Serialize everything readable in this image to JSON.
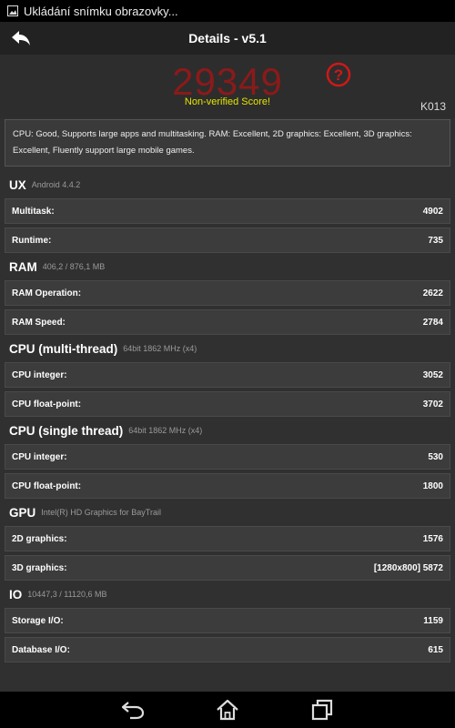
{
  "statusbar": {
    "text": "Ukládání snímku obrazovky..."
  },
  "actionbar": {
    "title": "Details - v5.1"
  },
  "score": {
    "value": "29349",
    "note": "Non-verified Score!",
    "device": "K013"
  },
  "summary": "CPU: Good, Supports large apps and multitasking. RAM: Excellent, 2D graphics: Excellent, 3D graphics: Excellent, Fluently support large mobile games.",
  "sections": [
    {
      "title": "UX",
      "subtitle": "Android 4.4.2",
      "rows": [
        {
          "label": "Multitask:",
          "value": "4902"
        },
        {
          "label": "Runtime:",
          "value": "735"
        }
      ]
    },
    {
      "title": "RAM",
      "subtitle": "406,2 / 876,1 MB",
      "rows": [
        {
          "label": "RAM Operation:",
          "value": "2622"
        },
        {
          "label": "RAM Speed:",
          "value": "2784"
        }
      ]
    },
    {
      "title": "CPU (multi-thread)",
      "subtitle": "64bit 1862 MHz (x4)",
      "rows": [
        {
          "label": "CPU integer:",
          "value": "3052"
        },
        {
          "label": "CPU float-point:",
          "value": "3702"
        }
      ]
    },
    {
      "title": "CPU (single thread)",
      "subtitle": "64bit 1862 MHz (x4)",
      "rows": [
        {
          "label": "CPU integer:",
          "value": "530"
        },
        {
          "label": "CPU float-point:",
          "value": "1800"
        }
      ]
    },
    {
      "title": "GPU",
      "subtitle": "Intel(R) HD Graphics for BayTrail",
      "rows": [
        {
          "label": "2D graphics:",
          "value": "1576"
        },
        {
          "label": "3D graphics:",
          "value": "[1280x800] 5872"
        }
      ]
    },
    {
      "title": "IO",
      "subtitle": "10447,3 / 11120,6 MB",
      "rows": [
        {
          "label": "Storage I/O:",
          "value": "1159"
        },
        {
          "label": "Database I/O:",
          "value": "615"
        }
      ]
    }
  ],
  "colors": {
    "score": "#8b1a1a",
    "note": "#e6e600",
    "help": "#d01818"
  },
  "icons": {
    "status": "image-icon",
    "back": "back-arrow-icon",
    "help": "help-icon",
    "nav": [
      "nav-back-icon",
      "nav-home-icon",
      "nav-recents-icon"
    ]
  }
}
